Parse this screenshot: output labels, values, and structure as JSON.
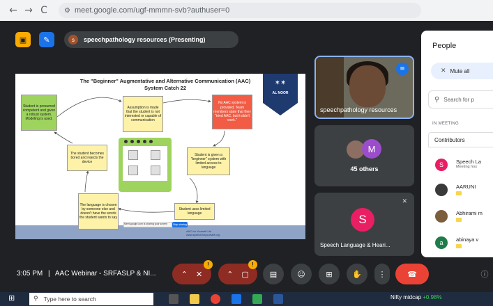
{
  "browser": {
    "back_icon": "←",
    "forward_icon": "→",
    "reload_icon": "C",
    "site_settings_icon": "⚙",
    "url": "meet.google.com/ugf-mmmn-svb?authuser=0"
  },
  "meet_top": {
    "presenting_label": "speechpathology resources (Presenting)",
    "presenter_initial": "s"
  },
  "slide": {
    "title": "The \"Beginner\" Augmentative and Alternative Communication (AAC) System Catch 22",
    "logo_text": "AL NOOR",
    "boxes": {
      "presumed": "Student is presumed competent and given a robust system. Modeling is used.",
      "assumption": "Assumption is made that the student is not interested or capable of communication",
      "no_aac": "No AAC system is provided. Team members state that they \"tried AAC, but it didn't work.\"",
      "bored": "The student becomes bored and rejects the device",
      "beginner": "Student is given a \"beginner\" system with limited access to language",
      "chosen": "The language is chosen by someone else and doesn't have the words the student wants to say",
      "limited": "Student uses limited language"
    },
    "footer_note": "Meet.google.com is sharing your screen",
    "stop_share": "Stop sharing",
    "credit_line1": "AAC for Yourself Ltd",
    "credit_line2": "www.speechforyourself.org"
  },
  "tiles": {
    "presenter_name": "speechpathology resources",
    "others_avatar_letter": "M",
    "others_count": "45 others",
    "speaker_letter": "S",
    "speaker_name": "Speech Language & Heari..."
  },
  "people_panel": {
    "title": "People",
    "mute_all": "Mute all",
    "search_placeholder": "Search for p",
    "in_meeting": "IN MEETING",
    "contributors": "Contributors",
    "participants": [
      {
        "initial": "S",
        "name": "Speech La",
        "sub": "Meeting hos",
        "color": "#e91e63"
      },
      {
        "initial": "",
        "name": "AARUNI",
        "sub": "",
        "color": "#3a3a3a"
      },
      {
        "initial": "",
        "name": "Abhirami m",
        "sub": "",
        "color": "#7b5e3c"
      },
      {
        "initial": "a",
        "name": "abinaya v",
        "sub": "",
        "color": "#1e7c4a"
      }
    ]
  },
  "bottom_bar": {
    "time": "3:05 PM",
    "separator": "|",
    "meeting_name": "AAC Webinar - SRFASLP & NI...",
    "badge_text": "!"
  },
  "taskbar": {
    "search_placeholder": "Type here to search",
    "ticker_name": "Nifty midcap",
    "ticker_change": "+0.98%"
  }
}
